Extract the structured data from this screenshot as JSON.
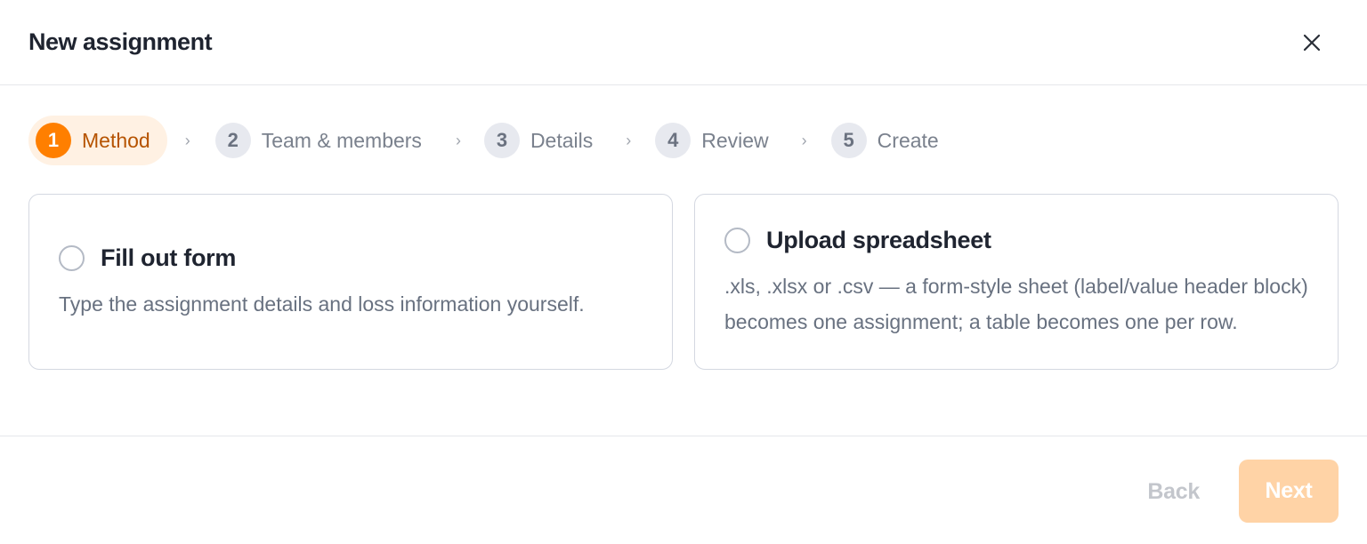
{
  "dialog": {
    "title": "New assignment",
    "close_icon": "close-icon"
  },
  "steps": [
    {
      "number": "1",
      "label": "Method",
      "state": "active"
    },
    {
      "number": "2",
      "label": "Team & members",
      "state": "inactive"
    },
    {
      "number": "3",
      "label": "Details",
      "state": "inactive"
    },
    {
      "number": "4",
      "label": "Review",
      "state": "inactive"
    },
    {
      "number": "5",
      "label": "Create",
      "state": "inactive"
    }
  ],
  "step_separator": "›",
  "options": [
    {
      "title": "Fill out form",
      "description": "Type the assignment details and loss information yourself.",
      "selected": false
    },
    {
      "title": "Upload spreadsheet",
      "description": ".xls, .xlsx or .csv — a form-style sheet (label/value header block) becomes one assignment; a table becomes one per row.",
      "selected": false
    }
  ],
  "footer": {
    "back_label": "Back",
    "next_label": "Next"
  },
  "colors": {
    "accent": "#ff7f00",
    "accent_soft": "#fff1e3",
    "next_disabled": "#ffd3a6"
  }
}
